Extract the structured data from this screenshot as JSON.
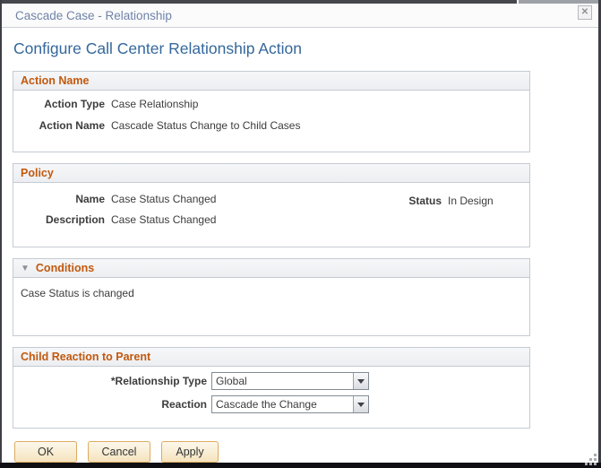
{
  "window": {
    "title": "Cascade Case - Relationship",
    "close_icon": "✕"
  },
  "page_title": "Configure Call Center Relationship Action",
  "sections": {
    "action_name": {
      "title": "Action Name",
      "action_type_label": "Action Type",
      "action_type_value": "Case Relationship",
      "action_name_label": "Action Name",
      "action_name_value": "Cascade Status Change to Child Cases"
    },
    "policy": {
      "title": "Policy",
      "name_label": "Name",
      "name_value": "Case Status Changed",
      "status_label": "Status",
      "status_value": "In Design",
      "description_label": "Description",
      "description_value": "Case Status Changed"
    },
    "conditions": {
      "title": "Conditions",
      "collapse_icon": "▼",
      "text": "Case Status is changed"
    },
    "child_reaction": {
      "title": "Child Reaction to Parent",
      "relationship_type_label": "*Relationship Type",
      "relationship_type_value": "Global",
      "reaction_label": "Reaction",
      "reaction_value": "Cascade the Change"
    }
  },
  "buttons": {
    "ok": "OK",
    "cancel": "Cancel",
    "apply": "Apply"
  },
  "colors": {
    "section_header_text": "#c2590e",
    "page_title_text": "#34689c",
    "window_title_text": "#6f83a7",
    "button_border": "#dcab62",
    "button_bg": "#f8ecce",
    "frame_dark": "#3e3f45"
  }
}
